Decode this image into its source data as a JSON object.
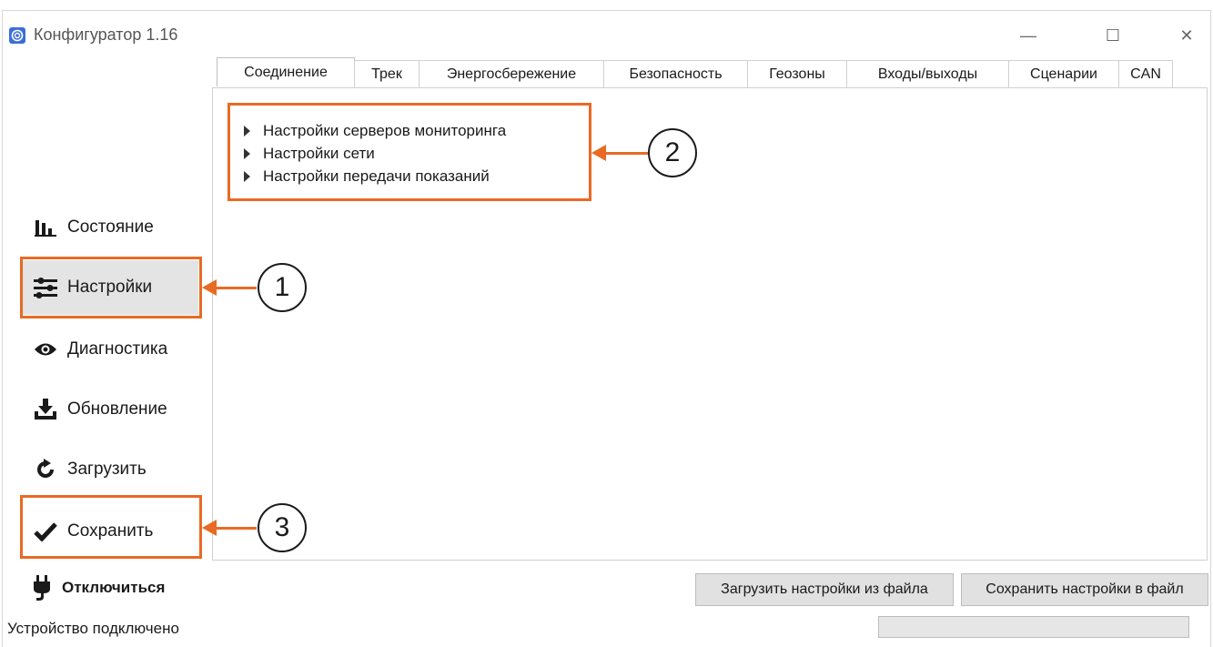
{
  "window": {
    "title": "Конфигуратор 1.16",
    "minimize": "—",
    "maximize": "☐",
    "close": "✕"
  },
  "sidebar": {
    "items": [
      {
        "label": "Состояние",
        "icon": "bar-chart-icon"
      },
      {
        "label": "Настройки",
        "icon": "sliders-icon",
        "active": true
      },
      {
        "label": "Диагностика",
        "icon": "eye-icon"
      },
      {
        "label": "Обновление",
        "icon": "download-icon"
      },
      {
        "label": "Загрузить",
        "icon": "refresh-icon"
      },
      {
        "label": "Сохранить",
        "icon": "checkmark-icon"
      }
    ],
    "disconnect": {
      "label": "Отключиться",
      "icon": "plug-icon"
    }
  },
  "tabs": [
    "Соединение",
    "Трек",
    "Энергосбережение",
    "Безопасность",
    "Геозоны",
    "Входы/выходы",
    "Сценарии",
    "CAN"
  ],
  "active_tab": "Соединение",
  "tree": [
    "Настройки серверов мониторинга",
    "Настройки сети",
    "Настройки передачи показаний"
  ],
  "buttons": {
    "load_from_file": "Загрузить настройки из файла",
    "save_to_file": "Сохранить настройки в файл"
  },
  "status": "Устройство подключено",
  "callouts": {
    "one": "1",
    "two": "2",
    "three": "3"
  },
  "colors": {
    "highlight": "#e96a23",
    "active_item": "#e4e4e4"
  }
}
